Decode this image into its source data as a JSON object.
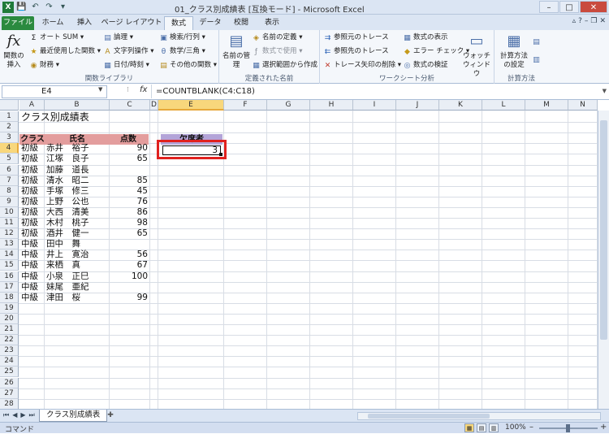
{
  "window": {
    "title": "01_クラス別成績表 [互換モード] - Microsoft Excel",
    "icon": "excel-icon"
  },
  "tabs": [
    "ファイル",
    "ホーム",
    "挿入",
    "ページ レイアウト",
    "数式",
    "データ",
    "校閲",
    "表示"
  ],
  "ribbon": {
    "library": {
      "insert_fn": "関数の挿入",
      "autosum": "オート SUM",
      "recent": "最近使用した関数",
      "finance": "財務",
      "logic": "論理",
      "text": "文字列操作",
      "datetime": "日付/時刻",
      "lookup": "検索/行列",
      "math": "数学/三角",
      "more": "その他の関数",
      "label": "関数ライブラリ"
    },
    "names": {
      "manager": "名前の管理",
      "define": "名前の定義",
      "use": "数式で使用",
      "create": "選択範囲から作成",
      "label": "定義された名前"
    },
    "audit": {
      "precedents": "参照元のトレース",
      "dependents": "参照先のトレース",
      "remove": "トレース矢印の削除",
      "show": "数式の表示",
      "error": "エラー チェック",
      "evaluate": "数式の検証",
      "watch": "ウォッチ ウィンドウ",
      "label": "ワークシート分析"
    },
    "calc": {
      "options": "計算方法の設定",
      "label": "計算方法"
    }
  },
  "formula_bar": {
    "name_box": "E4",
    "fx": "fx",
    "formula": "=COUNTBLANK(C4:C18)"
  },
  "columns": [
    "A",
    "B",
    "C",
    "D",
    "E",
    "F",
    "G",
    "H",
    "I",
    "J",
    "K",
    "L",
    "M",
    "N"
  ],
  "rows": [
    "1",
    "2",
    "3",
    "4",
    "5",
    "6",
    "7",
    "8",
    "9",
    "10",
    "11",
    "12",
    "13",
    "14",
    "15",
    "16",
    "17",
    "18",
    "19",
    "20",
    "21",
    "22",
    "23",
    "24",
    "25",
    "26",
    "27",
    "28"
  ],
  "sheet": {
    "title": "クラス別成績表",
    "headers": {
      "class": "クラス",
      "name": "氏名",
      "score": "点数",
      "absent": "欠席者"
    },
    "records": [
      {
        "class": "初級",
        "name": "赤井　裕子",
        "score": "90"
      },
      {
        "class": "初級",
        "name": "江塚　良子",
        "score": "65"
      },
      {
        "class": "初級",
        "name": "加藤　道長",
        "score": ""
      },
      {
        "class": "初級",
        "name": "清水　昭二",
        "score": "85"
      },
      {
        "class": "初級",
        "name": "手塚　修三",
        "score": "45"
      },
      {
        "class": "初級",
        "name": "上野　公也",
        "score": "76"
      },
      {
        "class": "初級",
        "name": "大西　清美",
        "score": "86"
      },
      {
        "class": "初級",
        "name": "木村　桃子",
        "score": "98"
      },
      {
        "class": "初級",
        "name": "酒井　健一",
        "score": "65"
      },
      {
        "class": "中級",
        "name": "田中　舞",
        "score": ""
      },
      {
        "class": "中級",
        "name": "井上　寛治",
        "score": "56"
      },
      {
        "class": "中級",
        "name": "来栖　真",
        "score": "67"
      },
      {
        "class": "中級",
        "name": "小泉　正巳",
        "score": "100"
      },
      {
        "class": "中級",
        "name": "妹尾　亜紀",
        "score": ""
      },
      {
        "class": "中級",
        "name": "津田　桜",
        "score": "99"
      }
    ],
    "absent_count": "3",
    "tab_name": "クラス別成績表"
  },
  "status": {
    "mode": "コマンド",
    "zoom": "100%"
  },
  "colors": {
    "header_red": "#e39d9d",
    "header_purple": "#b3a4d8",
    "highlight": "#e0211f",
    "file_tab": "#2a8a3f"
  }
}
